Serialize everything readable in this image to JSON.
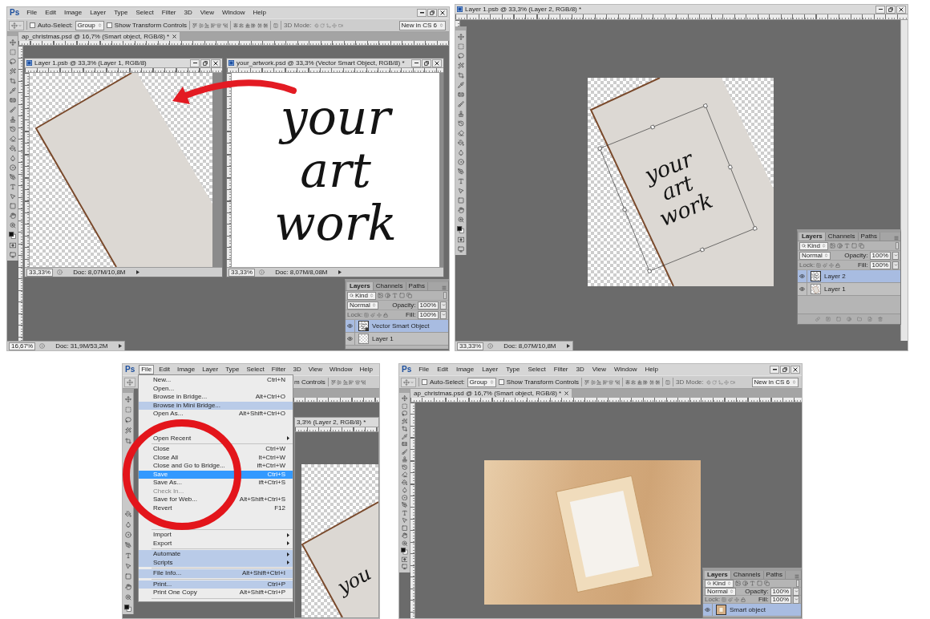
{
  "screens": [
    {
      "kind": "documents",
      "menu_bar": {
        "logo": "Ps",
        "items": [
          {
            "label": "File",
            "selected": false
          },
          {
            "label": "Edit",
            "selected": false
          },
          {
            "label": "Image",
            "selected": false
          },
          {
            "label": "Layer",
            "selected": false
          },
          {
            "label": "Type",
            "selected": false
          },
          {
            "label": "Select",
            "selected": false
          },
          {
            "label": "Filter",
            "selected": false
          },
          {
            "label": "3D",
            "selected": false
          },
          {
            "label": "View",
            "selected": false
          },
          {
            "label": "Window",
            "selected": false
          },
          {
            "label": "Help",
            "selected": false
          }
        ]
      },
      "options_bar": {
        "auto_select": {
          "label": "Auto-Select:",
          "checked": false
        },
        "target": "Group",
        "transform_controls": {
          "label": "Show Transform Controls",
          "checked": false
        },
        "mode_label": "3D Mode:",
        "workspace": "New in CS 6"
      },
      "document_tab": "ap_christmas.psd @ 16,7% (Smart object, RGB/8) *",
      "windows": [
        {
          "kind": "paper",
          "title": "Layer 1.psb @ 33,3% (Layer 1, RGB/8)",
          "zoom": "33,33%",
          "doc_size": "Doc: 8,07M/10,8M"
        },
        {
          "kind": "lettering",
          "title": "your_artwork.psd @ 33,3% (Vector Smart Object, RGB/8) *",
          "zoom": "33,33%",
          "doc_size": "Doc: 8,07M/8,08M",
          "lettering": [
            "your",
            "art",
            "work"
          ]
        }
      ],
      "layers_panel": {
        "tabs": [
          {
            "label": "Layers",
            "selected": true
          },
          {
            "label": "Channels",
            "selected": false
          },
          {
            "label": "Paths",
            "selected": false
          }
        ],
        "filter": "Kind",
        "blend_mode": "Normal",
        "opacity_label": "Opacity:",
        "opacity": "100%",
        "lock_label": "Lock:",
        "fill_label": "Fill:",
        "fill": "100%",
        "layers": [
          {
            "name": "Vector Smart Object",
            "kind": "smart",
            "selected": true,
            "visible": true
          },
          {
            "name": "Layer 1",
            "kind": "pixel",
            "selected": false,
            "visible": true
          }
        ]
      },
      "status_bar": {
        "zoom": "16,67%",
        "doc_size": "Doc: 31,9M/53,2M"
      }
    },
    {
      "kind": "transform",
      "document_title": "Layer 1.psb @ 33,3% (Layer 2, RGB/8) *",
      "lettering": [
        "your",
        "art",
        "work"
      ],
      "layers_panel": {
        "tabs": [
          {
            "label": "Layers",
            "selected": true
          },
          {
            "label": "Channels",
            "selected": false
          },
          {
            "label": "Paths",
            "selected": false
          }
        ],
        "filter": "Kind",
        "blend_mode": "Normal",
        "opacity_label": "Opacity:",
        "opacity": "100%",
        "lock_label": "Lock:",
        "fill_label": "Fill:",
        "fill": "100%",
        "layers": [
          {
            "name": "Layer 2",
            "kind": "lettering",
            "selected": true,
            "visible": true
          },
          {
            "name": "Layer 1",
            "kind": "paper",
            "selected": false,
            "visible": true
          }
        ],
        "footer": true
      },
      "status_bar": {
        "zoom": "33,33%",
        "doc_size": "Doc: 8,07M/10,8M"
      }
    },
    {
      "kind": "file_menu",
      "menu_bar": {
        "logo": "Ps",
        "items": [
          {
            "label": "File",
            "selected": true
          },
          {
            "label": "Edit",
            "selected": false
          },
          {
            "label": "Image",
            "selected": false
          },
          {
            "label": "Layer",
            "selected": false
          },
          {
            "label": "Type",
            "selected": false
          },
          {
            "label": "Select",
            "selected": false
          },
          {
            "label": "Filter",
            "selected": false
          },
          {
            "label": "3D",
            "selected": false
          },
          {
            "label": "View",
            "selected": false
          },
          {
            "label": "Window",
            "selected": false
          },
          {
            "label": "Help",
            "selected": false
          }
        ]
      },
      "options_bar": {
        "transform_controls": {
          "label": "m Controls"
        }
      },
      "document_title": "3,3% (Layer 2, RGB/8) *",
      "lettering": [
        "you"
      ],
      "menu": [
        {
          "kind": "item",
          "label": "New...",
          "shortcut": "Ctrl+N",
          "submenu": false,
          "selected": false,
          "highlighted": false,
          "disabled": false
        },
        {
          "kind": "item",
          "label": "Open...",
          "submenu": false,
          "selected": false,
          "highlighted": false,
          "disabled": false
        },
        {
          "kind": "item",
          "label": "Browse in Bridge...",
          "shortcut": "Alt+Ctrl+O",
          "submenu": false,
          "selected": false,
          "highlighted": false,
          "disabled": false
        },
        {
          "kind": "item",
          "label": "Browse in Mini Bridge...",
          "submenu": false,
          "selected": false,
          "highlighted": true,
          "disabled": false
        },
        {
          "kind": "item",
          "label": "Open As...",
          "shortcut": "Alt+Shift+Ctrl+O",
          "submenu": false,
          "selected": false,
          "highlighted": false,
          "disabled": false
        },
        {
          "kind": "spacer"
        },
        {
          "kind": "item",
          "label": "Open Recent",
          "submenu": true,
          "selected": false,
          "highlighted": false,
          "disabled": false
        },
        {
          "kind": "separator"
        },
        {
          "kind": "item",
          "label": "Close",
          "shortcut": "Ctrl+W",
          "submenu": false,
          "selected": false,
          "highlighted": false,
          "disabled": false
        },
        {
          "kind": "item",
          "label": "Close All",
          "shortcut": "lt+Ctrl+W",
          "submenu": false,
          "selected": false,
          "highlighted": false,
          "disabled": false
        },
        {
          "kind": "item",
          "label": "Close and Go to Bridge...",
          "shortcut": "ift+Ctrl+W",
          "submenu": false,
          "selected": false,
          "highlighted": false,
          "disabled": false
        },
        {
          "kind": "item",
          "label": "Save",
          "shortcut": "Ctrl+S",
          "submenu": false,
          "selected": true,
          "highlighted": false,
          "disabled": false
        },
        {
          "kind": "item",
          "label": "Save As...",
          "shortcut": "ift+Ctrl+S",
          "submenu": false,
          "selected": false,
          "highlighted": false,
          "disabled": false
        },
        {
          "kind": "item",
          "label": "Check In...",
          "submenu": false,
          "selected": false,
          "highlighted": false,
          "disabled": true
        },
        {
          "kind": "item",
          "label": "Save for Web...",
          "shortcut": "Alt+Shift+Ctrl+S",
          "submenu": false,
          "selected": false,
          "highlighted": false,
          "disabled": false
        },
        {
          "kind": "item",
          "label": "Revert",
          "shortcut": "F12",
          "submenu": false,
          "selected": false,
          "highlighted": false,
          "disabled": false
        },
        {
          "kind": "spacer"
        },
        {
          "kind": "separator"
        },
        {
          "kind": "item",
          "label": "Import",
          "submenu": true,
          "selected": false,
          "highlighted": false,
          "disabled": false
        },
        {
          "kind": "item",
          "label": "Export",
          "submenu": true,
          "selected": false,
          "highlighted": false,
          "disabled": false
        },
        {
          "kind": "separator"
        },
        {
          "kind": "item",
          "label": "Automate",
          "submenu": true,
          "selected": false,
          "highlighted": true,
          "disabled": false
        },
        {
          "kind": "item",
          "label": "Scripts",
          "submenu": true,
          "selected": false,
          "highlighted": true,
          "disabled": false
        },
        {
          "kind": "separator"
        },
        {
          "kind": "item",
          "label": "File Info...",
          "shortcut": "Alt+Shift+Ctrl+I",
          "submenu": false,
          "selected": false,
          "highlighted": true,
          "disabled": false
        },
        {
          "kind": "separator"
        },
        {
          "kind": "item",
          "label": "Print...",
          "shortcut": "Ctrl+P",
          "submenu": false,
          "selected": false,
          "highlighted": true,
          "disabled": false
        },
        {
          "kind": "item",
          "label": "Print One Copy",
          "shortcut": "Alt+Shift+Ctrl+P",
          "submenu": false,
          "selected": false,
          "highlighted": false,
          "disabled": false
        },
        {
          "kind": "separator"
        }
      ]
    },
    {
      "kind": "mockup",
      "menu_bar": {
        "logo": "Ps",
        "items": [
          {
            "label": "File",
            "selected": false
          },
          {
            "label": "Edit",
            "selected": false
          },
          {
            "label": "Image",
            "selected": false
          },
          {
            "label": "Layer",
            "selected": false
          },
          {
            "label": "Type",
            "selected": false
          },
          {
            "label": "Select",
            "selected": false
          },
          {
            "label": "Filter",
            "selected": false
          },
          {
            "label": "3D",
            "selected": false
          },
          {
            "label": "View",
            "selected": false
          },
          {
            "label": "Window",
            "selected": false
          },
          {
            "label": "Help",
            "selected": false
          }
        ]
      },
      "options_bar": {
        "auto_select": {
          "label": "Auto-Select:",
          "checked": false
        },
        "target": "Group",
        "transform_controls": {
          "label": "Show Transform Controls",
          "checked": false
        },
        "mode_label": "3D Mode:",
        "workspace": "New in CS 6"
      },
      "document_tab": "ap_christmas.psd @ 16,7% (Smart object, RGB/8) *",
      "layers_panel": {
        "tabs": [
          {
            "label": "Layers",
            "selected": true
          },
          {
            "label": "Channels",
            "selected": false
          },
          {
            "label": "Paths",
            "selected": false
          }
        ],
        "filter": "Kind",
        "blend_mode": "Normal",
        "opacity_label": "Opacity:",
        "opacity": "100%",
        "lock_label": "Lock:",
        "fill_label": "Fill:",
        "fill": "100%",
        "layers": [
          {
            "name": "Smart object",
            "kind": "photo",
            "selected": true,
            "visible": true
          }
        ]
      }
    }
  ]
}
